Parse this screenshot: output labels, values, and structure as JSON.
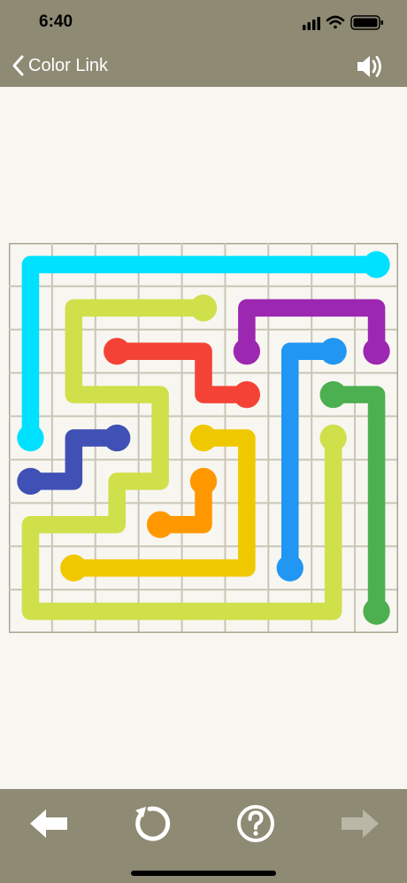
{
  "status_bar": {
    "time": "6:40"
  },
  "nav": {
    "back_label": "Color Link"
  },
  "board": {
    "size": 9,
    "colors": {
      "grid_line": "#c9c6b6",
      "board_bg": "#f8f6f0",
      "cyan": "#00e0ff",
      "lime": "#cfe04a",
      "purple": "#9c27b0",
      "red": "#f44336",
      "blue": "#2196f3",
      "green": "#4caf50",
      "indigo": "#3f51b5",
      "amber": "#f0c800",
      "orange": "#ff9800"
    },
    "paths": [
      {
        "name": "cyan",
        "color": "#00e0ff",
        "cells": [
          [
            8,
            0
          ],
          [
            0,
            0
          ],
          [
            0,
            4
          ]
        ]
      },
      {
        "name": "lime",
        "color": "#cfe04a",
        "cells": [
          [
            4,
            1
          ],
          [
            1,
            1
          ],
          [
            1,
            3
          ],
          [
            3,
            3
          ],
          [
            3,
            5
          ],
          [
            2,
            5
          ],
          [
            2,
            6
          ],
          [
            0,
            6
          ],
          [
            0,
            8
          ],
          [
            7,
            8
          ],
          [
            7,
            4
          ]
        ]
      },
      {
        "name": "purple",
        "color": "#9c27b0",
        "cells": [
          [
            5,
            2
          ],
          [
            5,
            1
          ],
          [
            8,
            1
          ],
          [
            8,
            2
          ]
        ]
      },
      {
        "name": "red",
        "color": "#f44336",
        "cells": [
          [
            2,
            2
          ],
          [
            4,
            2
          ],
          [
            4,
            3
          ],
          [
            5,
            3
          ]
        ]
      },
      {
        "name": "blue",
        "color": "#2196f3",
        "cells": [
          [
            7,
            2
          ],
          [
            6,
            2
          ],
          [
            6,
            7
          ]
        ]
      },
      {
        "name": "green",
        "color": "#4caf50",
        "cells": [
          [
            7,
            3
          ],
          [
            8,
            3
          ],
          [
            8,
            8
          ]
        ]
      },
      {
        "name": "indigo",
        "color": "#3f51b5",
        "cells": [
          [
            2,
            4
          ],
          [
            1,
            4
          ],
          [
            1,
            5
          ],
          [
            0,
            5
          ]
        ]
      },
      {
        "name": "amber",
        "color": "#f0c800",
        "cells": [
          [
            4,
            4
          ],
          [
            5,
            4
          ],
          [
            5,
            7
          ],
          [
            1,
            7
          ]
        ]
      },
      {
        "name": "orange",
        "color": "#ff9800",
        "cells": [
          [
            4,
            5
          ],
          [
            4,
            6
          ],
          [
            3,
            6
          ]
        ]
      }
    ]
  },
  "toolbar": {
    "icons": [
      "prev-arrow-icon",
      "restart-icon",
      "help-icon",
      "next-arrow-icon"
    ],
    "button_color": "#ffffff",
    "disabled_color": "#b9b7a6"
  }
}
